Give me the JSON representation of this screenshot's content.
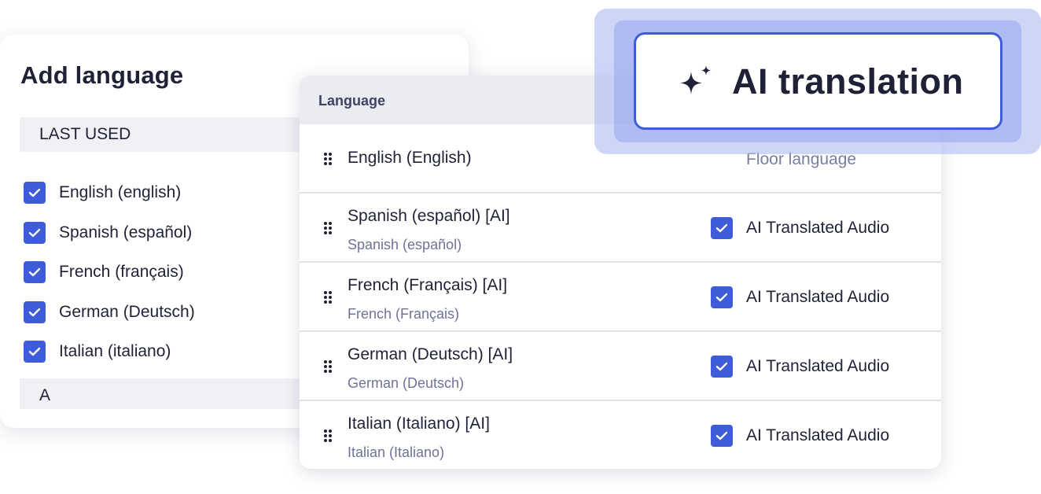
{
  "add_language": {
    "title": "Add language",
    "section_last_used": "LAST USED",
    "section_a": "A",
    "items": [
      {
        "label": "English (english)",
        "checked": true
      },
      {
        "label": "Spanish (español)",
        "checked": true
      },
      {
        "label": "French (français)",
        "checked": true
      },
      {
        "label": "German (Deutsch)",
        "checked": true
      },
      {
        "label": "Italian (italiano)",
        "checked": true
      }
    ]
  },
  "language_table": {
    "header": "Language",
    "rows": [
      {
        "name": "English (English)",
        "status": "Floor language"
      },
      {
        "name": "Spanish (español) [AI]",
        "subtitle": "Spanish (español)",
        "option_label": "AI Translated Audio",
        "checked": true
      },
      {
        "name": "French (Français) [AI]",
        "subtitle": "French (Français)",
        "option_label": "AI Translated Audio",
        "checked": true
      },
      {
        "name": "German (Deutsch) [AI]",
        "subtitle": "German (Deutsch)",
        "option_label": "AI Translated Audio",
        "checked": true
      },
      {
        "name": "Italian (Italiano) [AI]",
        "subtitle": "Italian (Italiano)",
        "option_label": "AI Translated Audio",
        "checked": true
      }
    ]
  },
  "ai_badge": {
    "label": "AI translation",
    "icon": "sparkle-icon"
  },
  "colors": {
    "accent": "#3e5bd9",
    "text": "#1f2237",
    "muted": "#6f7395",
    "glow": "#b0bdf3"
  }
}
